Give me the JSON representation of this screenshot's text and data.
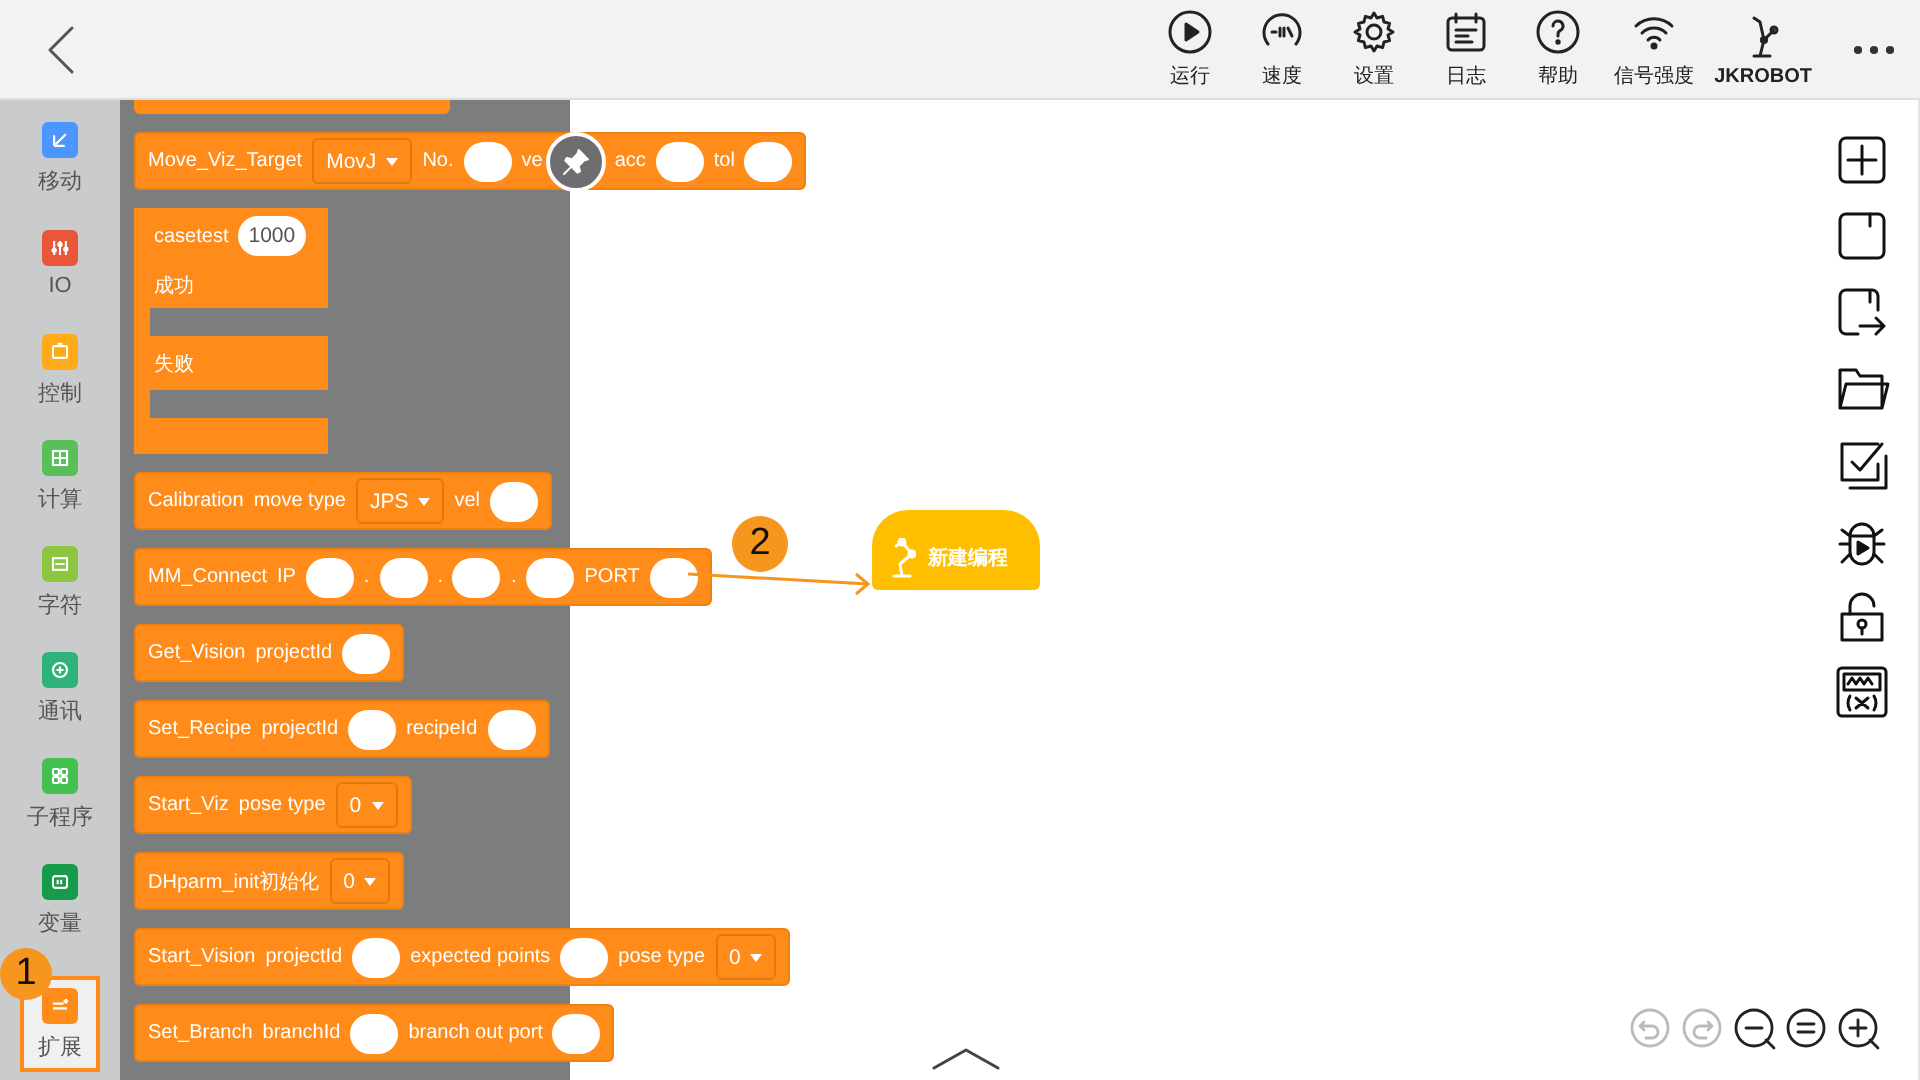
{
  "toolbar": {
    "items": [
      {
        "kind": "run",
        "label": "运行"
      },
      {
        "kind": "speed",
        "label": "速度"
      },
      {
        "kind": "settings",
        "label": "设置"
      },
      {
        "kind": "log",
        "label": "日志"
      },
      {
        "kind": "help",
        "label": "帮助"
      },
      {
        "kind": "signal",
        "label": "信号强度"
      },
      {
        "kind": "robot",
        "label": "JKROBOT"
      }
    ]
  },
  "sidebar": {
    "items": [
      {
        "label": "移动",
        "color": "#4c97ff",
        "selected": false
      },
      {
        "label": "IO",
        "color": "#e8573a",
        "selected": false
      },
      {
        "label": "控制",
        "color": "#ffab19",
        "selected": false
      },
      {
        "label": "计算",
        "color": "#59c059",
        "selected": false
      },
      {
        "label": "字符",
        "color": "#8cc63f",
        "selected": false
      },
      {
        "label": "通讯",
        "color": "#2fb37a",
        "selected": false
      },
      {
        "label": "子程序",
        "color": "#45c04e",
        "selected": false
      },
      {
        "label": "变量",
        "color": "#169b4b",
        "selected": false
      },
      {
        "label": "扩展",
        "color": "#ff8c1a",
        "selected": true
      }
    ]
  },
  "blocks": [
    {
      "kind": "stub"
    },
    {
      "kind": "statement",
      "parts": [
        {
          "kind": "text",
          "text": "Move_Viz_Target"
        },
        {
          "kind": "dropdown",
          "text": "MovJ"
        },
        {
          "kind": "text",
          "text": "No."
        },
        {
          "kind": "input"
        },
        {
          "kind": "text",
          "text": "ve"
        },
        {
          "kind": "pin"
        },
        {
          "kind": "text",
          "text": "acc"
        },
        {
          "kind": "input"
        },
        {
          "kind": "text",
          "text": "tol"
        },
        {
          "kind": "input"
        }
      ]
    },
    {
      "kind": "branch",
      "parts": [
        {
          "kind": "text",
          "text": "casetest"
        },
        {
          "kind": "input",
          "text": "1000"
        }
      ],
      "branches": [
        "成功",
        "失败"
      ]
    },
    {
      "kind": "statement",
      "parts": [
        {
          "kind": "text",
          "text": "Calibration"
        },
        {
          "kind": "text",
          "text": "move type"
        },
        {
          "kind": "dropdown",
          "text": "JPS"
        },
        {
          "kind": "text",
          "text": "vel"
        },
        {
          "kind": "input"
        }
      ]
    },
    {
      "kind": "statement",
      "parts": [
        {
          "kind": "text",
          "text": "MM_Connect"
        },
        {
          "kind": "text",
          "text": "IP"
        },
        {
          "kind": "input"
        },
        {
          "kind": "text",
          "text": "."
        },
        {
          "kind": "input"
        },
        {
          "kind": "text",
          "text": "."
        },
        {
          "kind": "input"
        },
        {
          "kind": "text",
          "text": "."
        },
        {
          "kind": "input"
        },
        {
          "kind": "text",
          "text": "PORT"
        },
        {
          "kind": "input"
        }
      ]
    },
    {
      "kind": "statement",
      "parts": [
        {
          "kind": "text",
          "text": "Get_Vision"
        },
        {
          "kind": "text",
          "text": "projectId"
        },
        {
          "kind": "input"
        }
      ]
    },
    {
      "kind": "statement",
      "parts": [
        {
          "kind": "text",
          "text": "Set_Recipe"
        },
        {
          "kind": "text",
          "text": "projectId"
        },
        {
          "kind": "input"
        },
        {
          "kind": "text",
          "text": "recipeId"
        },
        {
          "kind": "input"
        }
      ]
    },
    {
      "kind": "statement",
      "parts": [
        {
          "kind": "text",
          "text": "Start_Viz"
        },
        {
          "kind": "text",
          "text": "pose type"
        },
        {
          "kind": "dropdown",
          "text": "0"
        }
      ]
    },
    {
      "kind": "statement",
      "parts": [
        {
          "kind": "text",
          "text": "DHparm_init初始化"
        },
        {
          "kind": "dropdown",
          "text": "0"
        }
      ]
    },
    {
      "kind": "statement",
      "parts": [
        {
          "kind": "text",
          "text": "Start_Vision"
        },
        {
          "kind": "text",
          "text": "projectId"
        },
        {
          "kind": "input"
        },
        {
          "kind": "text",
          "text": "expected points"
        },
        {
          "kind": "input"
        },
        {
          "kind": "text",
          "text": "pose type"
        },
        {
          "kind": "dropdown",
          "text": "0"
        }
      ]
    },
    {
      "kind": "statement",
      "parts": [
        {
          "kind": "text",
          "text": "Set_Branch"
        },
        {
          "kind": "text",
          "text": "branchId"
        },
        {
          "kind": "input"
        },
        {
          "kind": "text",
          "text": "branch out port"
        },
        {
          "kind": "input"
        }
      ]
    }
  ],
  "start_block": {
    "label": "新建编程"
  },
  "callouts": [
    {
      "text": "1"
    },
    {
      "text": "2"
    }
  ],
  "right_tools": [
    {
      "kind": "new"
    },
    {
      "kind": "save"
    },
    {
      "kind": "save-as"
    },
    {
      "kind": "open"
    },
    {
      "kind": "check"
    },
    {
      "kind": "debug"
    },
    {
      "kind": "lock"
    },
    {
      "kind": "variable"
    }
  ],
  "zoom_tools": [
    {
      "kind": "undo",
      "disabled": true
    },
    {
      "kind": "redo",
      "disabled": true
    },
    {
      "kind": "zoom-out",
      "disabled": false
    },
    {
      "kind": "reset",
      "disabled": false
    },
    {
      "kind": "zoom-in",
      "disabled": false
    }
  ]
}
